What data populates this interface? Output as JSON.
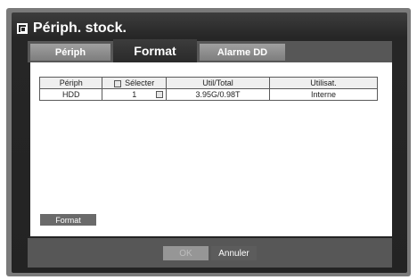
{
  "title": "Périph. stock.",
  "tabs": [
    {
      "label": "Périph"
    },
    {
      "label": "Format",
      "active": true
    },
    {
      "label": "Alarme DD"
    }
  ],
  "table": {
    "headers": [
      "Périph",
      "Sélecter",
      "Util/Total",
      "Utilisat."
    ],
    "rows": [
      {
        "device": "HDD",
        "select": "1",
        "selected": false,
        "usage": "3.95G/0.98T",
        "use": "Interne"
      }
    ]
  },
  "buttons": {
    "format": "Format",
    "ok": "OK",
    "cancel": "Annuler"
  },
  "colors": {
    "panel": "#262626",
    "tab_inactive": "#8c8c8c",
    "tab_active": "#333333",
    "content": "#ffffff"
  }
}
